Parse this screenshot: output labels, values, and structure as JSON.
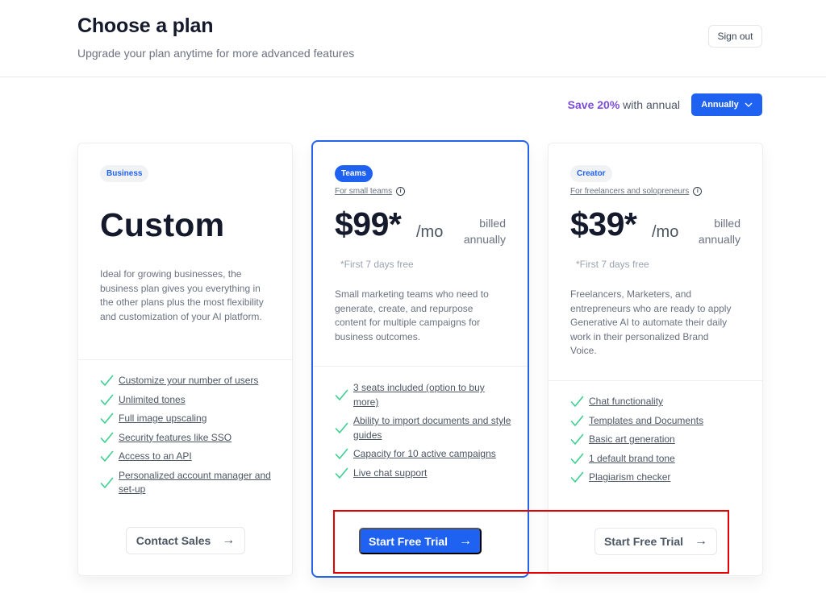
{
  "header": {
    "title": "Choose a plan",
    "subtitle": "Upgrade your plan anytime for more advanced features",
    "sign_out_label": "Sign out"
  },
  "billing": {
    "save_highlight": "Save 20%",
    "save_rest": " with annual",
    "period_selected": "Annually",
    "chevron_icon": "chevron-down-icon"
  },
  "plans": [
    {
      "badge": "Business",
      "headline": "Custom",
      "description": "Ideal for growing businesses, the business plan gives you everything in the other plans plus the most flexibility and customization of your AI platform.",
      "features": [
        "Customize your number of users",
        "Unlimited tones",
        "Full image upscaling",
        "Security features like SSO",
        "Access to an API",
        "Personalized account manager and set-up"
      ],
      "cta": "Contact Sales",
      "cta_icon": "arrow-right-icon"
    },
    {
      "badge": "Teams",
      "audience": "For small teams",
      "price": "$99*",
      "per": "/mo",
      "billed_line1": "billed",
      "billed_line2": "annually",
      "trial_note": "*First 7 days free",
      "description": "Small marketing teams who need to generate, create, and repurpose content for multiple campaigns for business outcomes.",
      "features": [
        "3 seats included (option to buy more)",
        "Ability to import documents and style guides",
        "Capacity for 10 active campaigns",
        "Live chat support"
      ],
      "cta": "Start Free Trial",
      "cta_icon": "arrow-right-icon",
      "featured": true
    },
    {
      "badge": "Creator",
      "audience": "For freelancers and solopreneurs",
      "price": "$39*",
      "per": "/mo",
      "billed_line1": "billed",
      "billed_line2": "annually",
      "trial_note": "*First 7 days free",
      "description": "Freelancers, Marketers, and entrepreneurs who are ready to apply Generative AI to automate their daily work in their personalized Brand Voice.",
      "features": [
        "Chat functionality",
        "Templates and Documents",
        "Basic art generation",
        "1 default brand tone",
        "Plagiarism checker"
      ],
      "cta": "Start Free Trial",
      "cta_icon": "arrow-right-icon"
    }
  ],
  "colors": {
    "accent": "#1f62f2",
    "save_purple": "#7c4ddb",
    "check_green": "#3ccf91",
    "highlight_red": "#e40000"
  },
  "glyphs": {
    "arrow": "→",
    "info": "i"
  }
}
